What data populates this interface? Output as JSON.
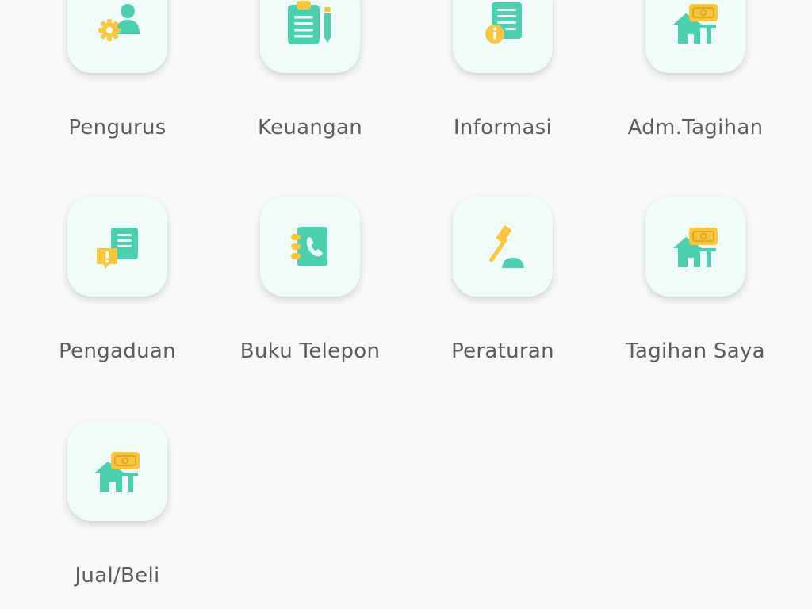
{
  "colors": {
    "background": "#f8f8f8",
    "tile": "#effcf9",
    "accent_teal": "#4ccfaf",
    "accent_yellow": "#f9c73f",
    "label": "#5c5c5c"
  },
  "menu": [
    {
      "label": "Pengurus",
      "icon": "admin-gear-user-icon"
    },
    {
      "label": "Keuangan",
      "icon": "clipboard-pencil-icon"
    },
    {
      "label": "Informasi",
      "icon": "info-document-icon"
    },
    {
      "label": "Adm.Tagihan",
      "icon": "house-money-icon"
    },
    {
      "label": "Pengaduan",
      "icon": "complaint-chat-icon"
    },
    {
      "label": "Buku Telepon",
      "icon": "phone-book-icon"
    },
    {
      "label": "Peraturan",
      "icon": "gavel-icon"
    },
    {
      "label": "Tagihan Saya",
      "icon": "house-money-icon"
    },
    {
      "label": "Jual/Beli",
      "icon": "house-money-icon"
    }
  ]
}
